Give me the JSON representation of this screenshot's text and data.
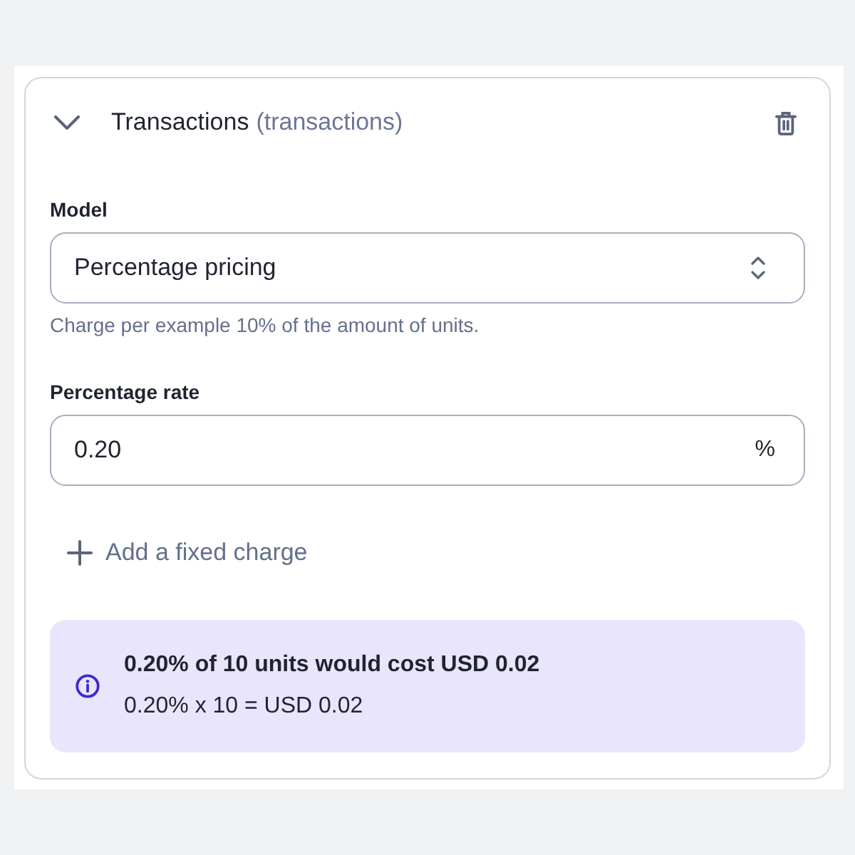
{
  "section": {
    "title": "Transactions",
    "key": "(transactions)",
    "expanded": true
  },
  "fields": [
    {
      "kind": "select",
      "label": "Model",
      "value": "Percentage pricing",
      "hint": "Charge per example 10% of the amount of units."
    },
    {
      "kind": "number",
      "label": "Percentage rate",
      "value": "0.20",
      "suffix": "%"
    }
  ],
  "add_action": {
    "label": "Add a fixed charge"
  },
  "info": {
    "title": "0.20% of 10 units would cost USD 0.02",
    "formula": "0.20% x 10 = USD 0.02"
  }
}
